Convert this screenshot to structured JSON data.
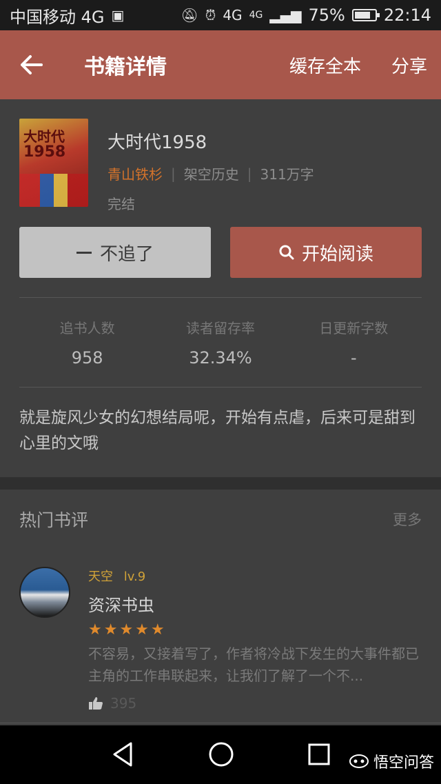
{
  "status_bar": {
    "carrier": "中国移动 4G",
    "network_left": "4G",
    "network_right": "4G",
    "battery": "75%",
    "time": "22:14"
  },
  "app_bar": {
    "title": "书籍详情",
    "cache_all": "缓存全本",
    "share": "分享"
  },
  "book": {
    "cover_line1": "大时代",
    "cover_line2": "1958",
    "title": "大时代1958",
    "author": "青山铁杉",
    "category": "架空历史",
    "word_count": "311万字",
    "status": "完结"
  },
  "buttons": {
    "unfollow": "不追了",
    "start_reading": "开始阅读"
  },
  "stats": [
    {
      "label": "追书人数",
      "value": "958"
    },
    {
      "label": "读者留存率",
      "value": "32.34%"
    },
    {
      "label": "日更新字数",
      "value": "-"
    }
  ],
  "description": "就是旋风少女的幻想结局呢，开始有点虐，后来可是甜到心里的文哦",
  "reviews": {
    "section_title": "热门书评",
    "more": "更多",
    "items": [
      {
        "username": "天空",
        "level": "lv.9",
        "title": "资深书虫",
        "stars": "★★★★★",
        "rating": 5,
        "text": "不容易，又接着写了，作者将冷战下发生的大事件都已主角的工作串联起来，让我们了解了一个不...",
        "likes": "395"
      }
    ]
  },
  "watermark": "悟空问答",
  "colors": {
    "accent": "#a8574b",
    "author": "#d4732b",
    "star": "#e08a2c",
    "username": "#d0a238"
  }
}
